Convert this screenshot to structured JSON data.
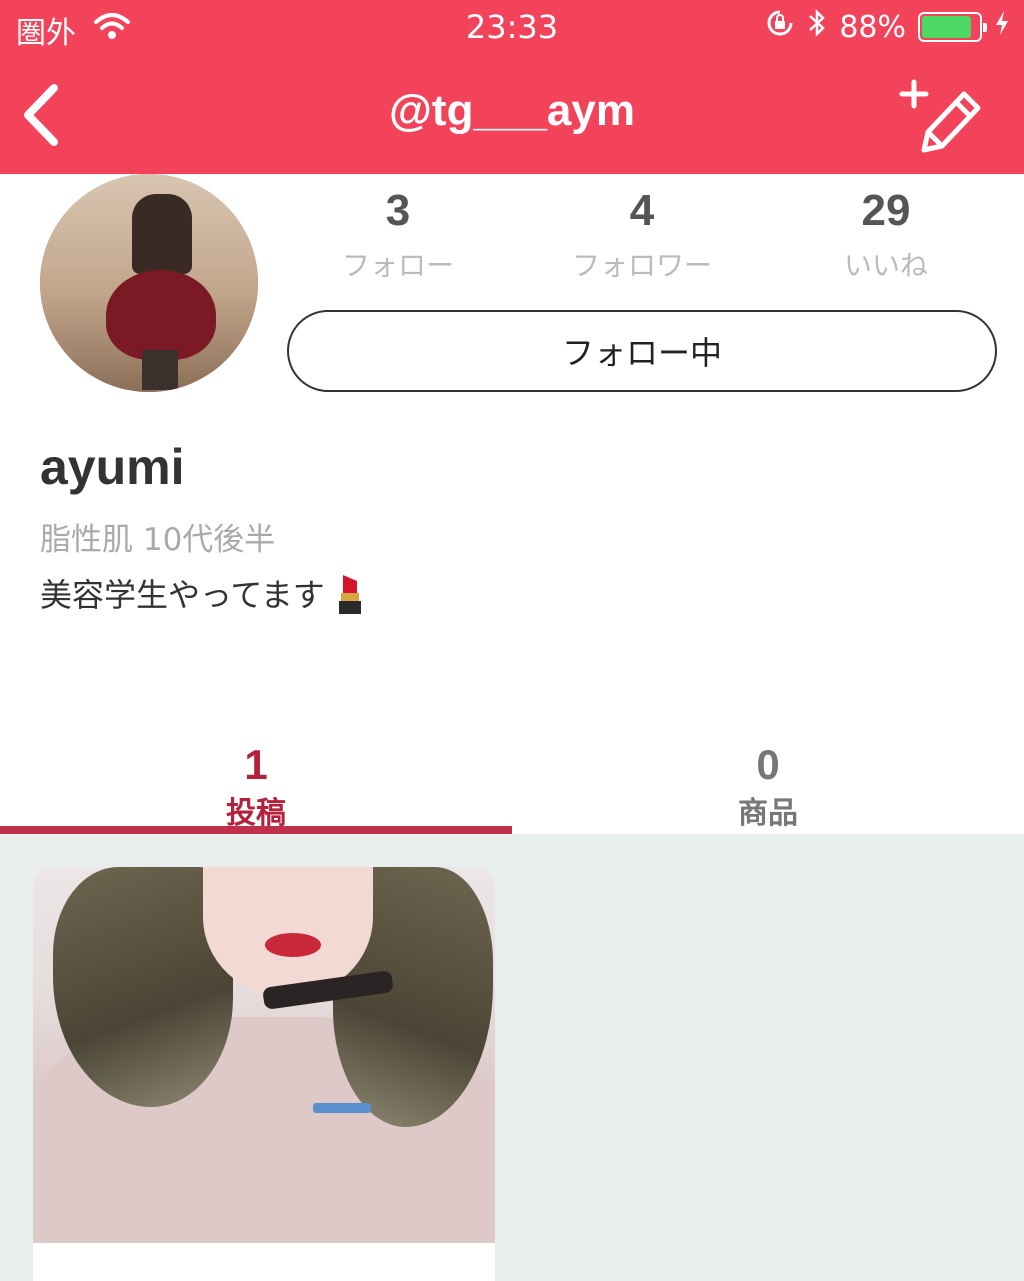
{
  "status_bar": {
    "carrier": "圏外",
    "time": "23:33",
    "battery_percent": "88%",
    "battery_level": 0.88,
    "icons": [
      "wifi-icon",
      "orientation-lock-icon",
      "bluetooth-icon",
      "battery-icon",
      "charging-icon"
    ]
  },
  "header": {
    "title": "@tg___aym",
    "back_icon": "chevron-left-icon",
    "compose_icon": "compose-pencil-icon",
    "bg_color": "#f2435a"
  },
  "profile": {
    "stats": [
      {
        "count": "3",
        "label": "フォロー"
      },
      {
        "count": "4",
        "label": "フォロワー"
      },
      {
        "count": "29",
        "label": "いいね"
      }
    ],
    "follow_button": "フォロー中",
    "name": "ayumi",
    "meta": "脂性肌  10代後半",
    "bio": "美容学生やってます",
    "bio_emoji": "lipstick-icon"
  },
  "tabs": [
    {
      "count": "1",
      "label": "投稿",
      "active": true
    },
    {
      "count": "0",
      "label": "商品",
      "active": false
    }
  ],
  "colors": {
    "accent": "#f2435a",
    "tab_active": "#b3223a",
    "feed_bg": "#e8eeed"
  }
}
